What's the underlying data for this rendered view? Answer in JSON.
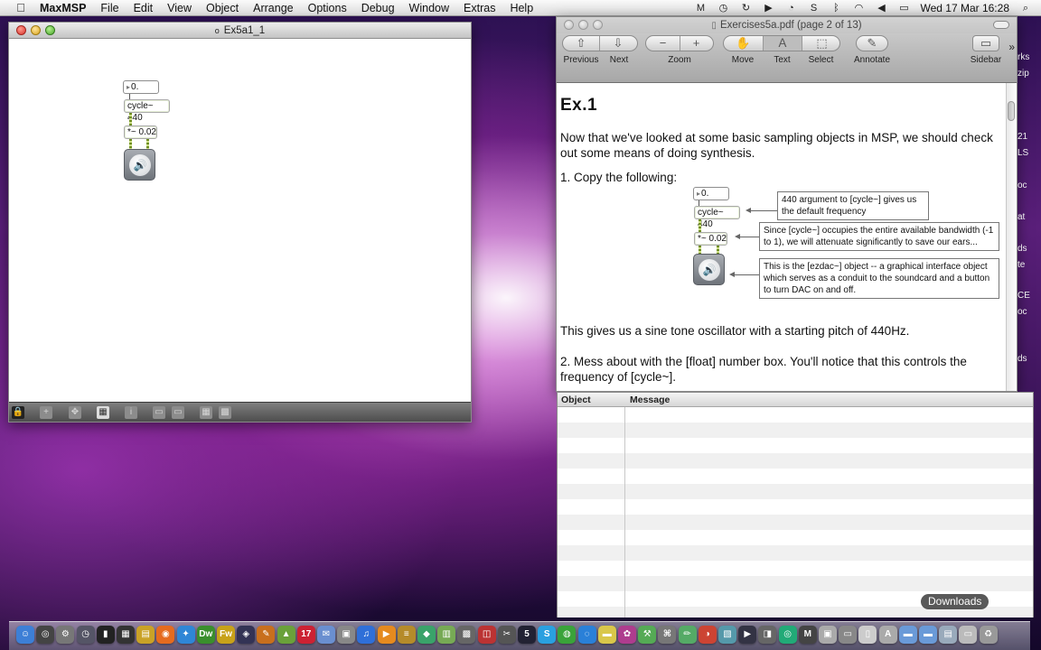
{
  "menubar": {
    "app_name": "MaxMSP",
    "items": [
      "File",
      "Edit",
      "View",
      "Object",
      "Arrange",
      "Options",
      "Debug",
      "Window",
      "Extras",
      "Help"
    ],
    "clock": "Wed 17 Mar  16:28",
    "status_icons": [
      "apple-icon",
      "m-icon",
      "time-machine-icon",
      "sync-icon",
      "play-icon",
      "clock-icon",
      "skype-icon",
      "bluetooth-icon",
      "wifi-icon",
      "volume-icon",
      "battery-icon",
      "spotlight-icon"
    ]
  },
  "patcher": {
    "title": "Ex5a1_1",
    "objects": {
      "number": "0.",
      "cycle": "cycle~ 440",
      "multiply": "*~ 0.02"
    }
  },
  "preview": {
    "title": "Exercises5a.pdf (page 2 of 13)",
    "toolbar": {
      "previous": "Previous",
      "next": "Next",
      "zoom": "Zoom",
      "move": "Move",
      "text": "Text",
      "select": "Select",
      "annotate": "Annotate",
      "sidebar": "Sidebar"
    },
    "doc": {
      "heading": "Ex.1",
      "intro": "Now that we've looked at some basic sampling objects in MSP, we should check out some means of doing synthesis.",
      "step1": "1. Copy the following:",
      "fig_number": "0.",
      "fig_cycle": "cycle~ 440",
      "fig_multiply": "*~ 0.02",
      "note1": "440 argument to [cycle~] gives us the default frequency",
      "note2": "Since [cycle~] occupies the entire available bandwidth (-1 to 1), we will attenuate significantly to save our ears...",
      "note3": "This is the [ezdac~] object -- a graphical interface object which serves as a conduit to the soundcard and a button to turn DAC on and off.",
      "para2": "This gives us a sine tone oscillator with a starting pitch of 440Hz.",
      "step2": "2. Mess about with the [float] number box. You'll notice that this controls the frequency of [cycle~]."
    }
  },
  "console": {
    "col_object": "Object",
    "col_message": "Message"
  },
  "edge_fragments": [
    "rks",
    "zip",
    "21",
    "LS",
    "oc",
    "at",
    "ds",
    "te",
    "CE",
    "oc",
    "ds"
  ],
  "downloads_tooltip": "Downloads",
  "dock": {
    "icons": [
      {
        "name": "finder-icon",
        "glyph": "☺",
        "color": "#3d7fd6"
      },
      {
        "name": "dashboard-icon",
        "glyph": "◎",
        "color": "#444"
      },
      {
        "name": "system-prefs-icon",
        "glyph": "⚙",
        "color": "#777"
      },
      {
        "name": "timemachine-icon",
        "glyph": "◷",
        "color": "#556"
      },
      {
        "name": "terminal-icon",
        "glyph": "▮",
        "color": "#222"
      },
      {
        "name": "piano-icon",
        "glyph": "▦",
        "color": "#333"
      },
      {
        "name": "notes-icon",
        "glyph": "▤",
        "color": "#c9a227"
      },
      {
        "name": "firefox-icon",
        "glyph": "◉",
        "color": "#e56b1f"
      },
      {
        "name": "safari-icon",
        "glyph": "✦",
        "color": "#2f86d6"
      },
      {
        "name": "dreamweaver-icon",
        "glyph": "Dw",
        "color": "#3a8f2d"
      },
      {
        "name": "fireworks-icon",
        "glyph": "Fw",
        "color": "#c8a21a"
      },
      {
        "name": "photoshop-icon",
        "glyph": "◈",
        "color": "#335"
      },
      {
        "name": "illustrator-icon",
        "glyph": "✎",
        "color": "#c86f1d"
      },
      {
        "name": "maps-icon",
        "glyph": "▲",
        "color": "#6aa13a"
      },
      {
        "name": "ical-icon",
        "glyph": "17",
        "color": "#c23"
      },
      {
        "name": "mail-icon",
        "glyph": "✉",
        "color": "#6a8fd0"
      },
      {
        "name": "preview-icon",
        "glyph": "▣",
        "color": "#888"
      },
      {
        "name": "itunes-icon",
        "glyph": "♫",
        "color": "#2f6fd8"
      },
      {
        "name": "vlc-icon",
        "glyph": "▶",
        "color": "#e58a1f"
      },
      {
        "name": "textedit-icon",
        "glyph": "≡",
        "color": "#b58b2a"
      },
      {
        "name": "sketch-icon",
        "glyph": "◆",
        "color": "#3aa36a"
      },
      {
        "name": "books-icon",
        "glyph": "▥",
        "color": "#7a5"
      },
      {
        "name": "mixer-icon",
        "glyph": "▩",
        "color": "#666"
      },
      {
        "name": "pdf-icon",
        "glyph": "◫",
        "color": "#b33"
      },
      {
        "name": "tool-icon",
        "glyph": "✂",
        "color": "#555"
      },
      {
        "name": "five-icon",
        "glyph": "5",
        "color": "#223"
      },
      {
        "name": "skype-icon",
        "glyph": "S",
        "color": "#2aa0e0"
      },
      {
        "name": "spotify-icon",
        "glyph": "◍",
        "color": "#3aa33a"
      },
      {
        "name": "ichat-icon",
        "glyph": "◌",
        "color": "#2a80d8"
      },
      {
        "name": "stickies-icon",
        "glyph": "▬",
        "color": "#d9c74a"
      },
      {
        "name": "flower-icon",
        "glyph": "✿",
        "color": "#ae3c8e"
      },
      {
        "name": "utility-icon",
        "glyph": "⚒",
        "color": "#5a5"
      },
      {
        "name": "network-icon",
        "glyph": "⌘",
        "color": "#777"
      },
      {
        "name": "pencil-icon",
        "glyph": "✏",
        "color": "#5a6"
      },
      {
        "name": "coda-icon",
        "glyph": "◑",
        "color": "#c43"
      },
      {
        "name": "chart-icon",
        "glyph": "▧",
        "color": "#59a"
      },
      {
        "name": "film-icon",
        "glyph": "▶",
        "color": "#334"
      },
      {
        "name": "clapper-icon",
        "glyph": "◨",
        "color": "#666"
      },
      {
        "name": "globe-icon",
        "glyph": "◎",
        "color": "#2a7"
      },
      {
        "name": "max-icon",
        "glyph": "M",
        "color": "#444"
      },
      {
        "name": "box-icon",
        "glyph": "▣",
        "color": "#aaa"
      },
      {
        "name": "drive-icon",
        "glyph": "▭",
        "color": "#888"
      },
      {
        "name": "doc-icon",
        "glyph": "▯",
        "color": "#ccc"
      },
      {
        "name": "font-icon",
        "glyph": "A",
        "color": "#aaa"
      },
      {
        "name": "folder-icon",
        "glyph": "▬",
        "color": "#6a9ad8"
      },
      {
        "name": "downloads-folder-icon",
        "glyph": "▬",
        "color": "#6a9ad8"
      },
      {
        "name": "stack-icon",
        "glyph": "▤",
        "color": "#9ab"
      },
      {
        "name": "window-icon",
        "glyph": "▭",
        "color": "#bbb"
      },
      {
        "name": "trash-icon",
        "glyph": "♻",
        "color": "#999"
      }
    ]
  }
}
